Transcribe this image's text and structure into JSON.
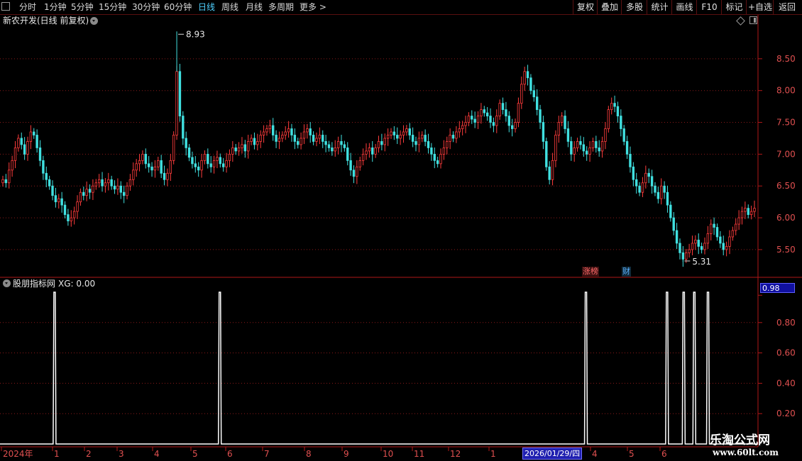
{
  "toolbar": {
    "periods": [
      {
        "label": "分时",
        "active": false
      },
      {
        "label": "1分钟",
        "active": false
      },
      {
        "label": "5分钟",
        "active": false
      },
      {
        "label": "15分钟",
        "active": false
      },
      {
        "label": "30分钟",
        "active": false
      },
      {
        "label": "60分钟",
        "active": false
      },
      {
        "label": "日线",
        "active": true
      },
      {
        "label": "周线",
        "active": false
      },
      {
        "label": "月线",
        "active": false
      },
      {
        "label": "多周期",
        "active": false
      },
      {
        "label": "更多 >",
        "active": false
      }
    ],
    "right_buttons": [
      "复权",
      "叠加",
      "多股",
      "统计",
      "画线",
      "F10",
      "标记",
      "+自选",
      "返回"
    ]
  },
  "main_panel": {
    "title": "新农开发(日线 前复权)",
    "badges": [
      "涨榜",
      "财"
    ],
    "high_label": "8.93",
    "low_label": "5.31"
  },
  "indicator_panel": {
    "title": "股朋指标网",
    "xg_label": "XG: 0.00",
    "current_value": "0.98"
  },
  "x_axis": {
    "labels": [
      "2024年",
      "1",
      "2",
      "3",
      "4",
      "5",
      "6",
      "7",
      "8",
      "9",
      "10",
      "11",
      "12",
      "1",
      "4",
      "5",
      "6"
    ],
    "cursor_date": "2026/01/29/四"
  },
  "watermark": {
    "line1": "乐淘公式网",
    "line2": "www.60lt.com"
  },
  "colors": {
    "up": "#ff3c3c",
    "down": "#40e0e0",
    "grid": "#8b1a1a",
    "axis": "#b01818",
    "signal": "#ffffff"
  },
  "chart_data": [
    {
      "type": "candlestick",
      "title": "新农开发(日线 前复权)",
      "y_axis_labels": [
        "8.50",
        "8.00",
        "7.50",
        "7.00",
        "6.50",
        "6.00",
        "5.50"
      ],
      "ylim": [
        5.12,
        9.0
      ],
      "grid": true,
      "marked_high": 8.93,
      "marked_low": 5.31,
      "close_series_approx": [
        6.6,
        6.55,
        6.75,
        6.9,
        7.1,
        7.25,
        7.15,
        7.0,
        7.2,
        7.35,
        7.3,
        7.1,
        6.9,
        6.7,
        6.6,
        6.5,
        6.35,
        6.25,
        6.3,
        6.2,
        6.05,
        5.95,
        6.0,
        6.1,
        6.25,
        6.4,
        6.35,
        6.45,
        6.4,
        6.5,
        6.55,
        6.6,
        6.5,
        6.55,
        6.6,
        6.5,
        6.45,
        6.5,
        6.4,
        6.35,
        6.5,
        6.6,
        6.75,
        6.85,
        6.9,
        7.0,
        6.85,
        6.8,
        6.75,
        6.8,
        6.9,
        6.7,
        6.6,
        6.7,
        6.9,
        7.3,
        8.3,
        7.6,
        7.25,
        7.1,
        6.95,
        6.85,
        6.8,
        6.75,
        6.9,
        7.0,
        6.85,
        6.8,
        6.9,
        6.95,
        6.85,
        6.8,
        6.9,
        7.0,
        7.1,
        7.05,
        7.1,
        7.15,
        7.05,
        7.2,
        7.25,
        7.15,
        7.2,
        7.3,
        7.35,
        7.4,
        7.45,
        7.3,
        7.2,
        7.25,
        7.3,
        7.35,
        7.4,
        7.3,
        7.2,
        7.15,
        7.25,
        7.35,
        7.4,
        7.3,
        7.2,
        7.25,
        7.3,
        7.2,
        7.15,
        7.1,
        7.05,
        7.1,
        7.2,
        7.15,
        7.1,
        6.9,
        6.75,
        6.65,
        6.8,
        6.9,
        7.0,
        7.05,
        7.1,
        7.0,
        7.1,
        7.2,
        7.15,
        7.25,
        7.3,
        7.35,
        7.3,
        7.25,
        7.3,
        7.35,
        7.4,
        7.3,
        7.2,
        7.15,
        7.25,
        7.3,
        7.2,
        7.1,
        7.0,
        6.9,
        6.85,
        7.0,
        7.1,
        7.2,
        7.3,
        7.25,
        7.35,
        7.4,
        7.45,
        7.5,
        7.6,
        7.55,
        7.5,
        7.6,
        7.7,
        7.65,
        7.6,
        7.5,
        7.45,
        7.6,
        7.8,
        7.7,
        7.6,
        7.45,
        7.4,
        7.5,
        7.8,
        8.1,
        8.3,
        8.2,
        8.0,
        7.9,
        7.7,
        7.5,
        7.2,
        6.8,
        6.6,
        6.9,
        7.3,
        7.5,
        7.6,
        7.4,
        7.2,
        7.0,
        7.1,
        7.2,
        7.15,
        7.05,
        7.0,
        7.1,
        7.2,
        7.1,
        7.05,
        7.2,
        7.4,
        7.7,
        7.8,
        7.75,
        7.6,
        7.4,
        7.2,
        7.0,
        6.8,
        6.6,
        6.5,
        6.4,
        6.55,
        6.7,
        6.65,
        6.5,
        6.4,
        6.3,
        6.5,
        6.4,
        6.2,
        6.0,
        5.8,
        5.6,
        5.45,
        5.35,
        5.45,
        5.5,
        5.6,
        5.65,
        5.55,
        5.5,
        5.6,
        5.75,
        5.9,
        5.85,
        5.7,
        5.6,
        5.5,
        5.55,
        5.7,
        5.8,
        5.9,
        6.0,
        6.1,
        6.15,
        6.05,
        6.1,
        6.15
      ]
    },
    {
      "type": "line",
      "title": "股朋指标网",
      "series_name": "XG",
      "y_axis_labels": [
        "0.98",
        "0.80",
        "0.60",
        "0.40",
        "0.20"
      ],
      "ylim": [
        0,
        1
      ],
      "signal_fraction_positions": [
        0.072,
        0.29,
        0.773,
        0.88,
        0.902,
        0.916,
        0.934
      ],
      "signal_value": 1.0
    }
  ]
}
